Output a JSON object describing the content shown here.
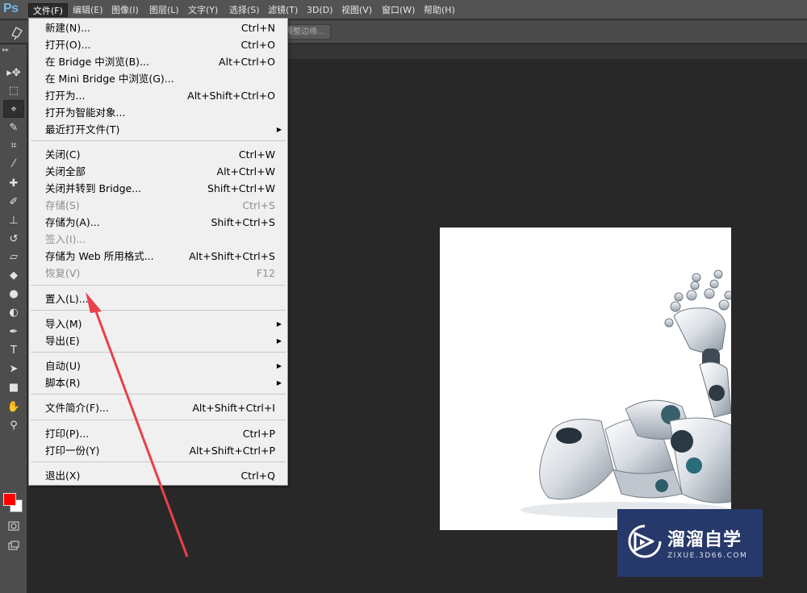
{
  "app": {
    "logo": "Ps"
  },
  "menubar": {
    "items": [
      {
        "label": "文件(F)",
        "active": true
      },
      {
        "label": "编辑(E)"
      },
      {
        "label": "图像(I)"
      },
      {
        "label": "图层(L)"
      },
      {
        "label": "文字(Y)"
      },
      {
        "label": "选择(S)"
      },
      {
        "label": "滤镜(T)"
      },
      {
        "label": "3D(D)"
      },
      {
        "label": "视图(V)"
      },
      {
        "label": "窗口(W)"
      },
      {
        "label": "帮助(H)"
      }
    ]
  },
  "options": {
    "refine_edge_label": "调整边缘..."
  },
  "file_menu": {
    "items": [
      {
        "label": "新建(N)...",
        "shortcut": "Ctrl+N"
      },
      {
        "label": "打开(O)...",
        "shortcut": "Ctrl+O"
      },
      {
        "label": "在 Bridge 中浏览(B)...",
        "shortcut": "Alt+Ctrl+O"
      },
      {
        "label": "在 Mini Bridge 中浏览(G)...",
        "shortcut": ""
      },
      {
        "label": "打开为...",
        "shortcut": "Alt+Shift+Ctrl+O"
      },
      {
        "label": "打开为智能对象...",
        "shortcut": ""
      },
      {
        "label": "最近打开文件(T)",
        "shortcut": "",
        "submenu": true
      },
      {
        "label": "关闭(C)",
        "shortcut": "Ctrl+W"
      },
      {
        "label": "关闭全部",
        "shortcut": "Alt+Ctrl+W"
      },
      {
        "label": "关闭并转到 Bridge...",
        "shortcut": "Shift+Ctrl+W"
      },
      {
        "label": "存储(S)",
        "shortcut": "Ctrl+S",
        "disabled": true
      },
      {
        "label": "存储为(A)...",
        "shortcut": "Shift+Ctrl+S"
      },
      {
        "label": "签入(I)...",
        "shortcut": "",
        "disabled": true
      },
      {
        "label": "存储为 Web 所用格式...",
        "shortcut": "Alt+Shift+Ctrl+S"
      },
      {
        "label": "恢复(V)",
        "shortcut": "F12",
        "disabled": true
      },
      {
        "label": "置入(L)...",
        "shortcut": ""
      },
      {
        "label": "导入(M)",
        "shortcut": "",
        "submenu": true
      },
      {
        "label": "导出(E)",
        "shortcut": "",
        "submenu": true
      },
      {
        "label": "自动(U)",
        "shortcut": "",
        "submenu": true
      },
      {
        "label": "脚本(R)",
        "shortcut": "",
        "submenu": true
      },
      {
        "label": "文件简介(F)...",
        "shortcut": "Alt+Shift+Ctrl+I"
      },
      {
        "label": "打印(P)...",
        "shortcut": "Ctrl+P"
      },
      {
        "label": "打印一份(Y)",
        "shortcut": "Alt+Shift+Ctrl+P"
      },
      {
        "label": "退出(X)",
        "shortcut": "Ctrl+Q"
      }
    ]
  },
  "tools": [
    {
      "name": "move-tool-icon",
      "glyph": "▸✥"
    },
    {
      "name": "marquee-tool-icon",
      "glyph": "⬚"
    },
    {
      "name": "lasso-tool-icon",
      "glyph": "⌖"
    },
    {
      "name": "quick-select-tool-icon",
      "glyph": "✎"
    },
    {
      "name": "crop-tool-icon",
      "glyph": "⌗"
    },
    {
      "name": "eyedropper-tool-icon",
      "glyph": "⁄"
    },
    {
      "name": "healing-brush-tool-icon",
      "glyph": "✚"
    },
    {
      "name": "brush-tool-icon",
      "glyph": "✐"
    },
    {
      "name": "clone-stamp-tool-icon",
      "glyph": "⊥"
    },
    {
      "name": "history-brush-tool-icon",
      "glyph": "↺"
    },
    {
      "name": "eraser-tool-icon",
      "glyph": "▱"
    },
    {
      "name": "paint-bucket-tool-icon",
      "glyph": "◆"
    },
    {
      "name": "blur-tool-icon",
      "glyph": "●"
    },
    {
      "name": "dodge-tool-icon",
      "glyph": "◐"
    },
    {
      "name": "pen-tool-icon",
      "glyph": "✒"
    },
    {
      "name": "type-tool-icon",
      "glyph": "T"
    },
    {
      "name": "path-select-tool-icon",
      "glyph": "➤"
    },
    {
      "name": "rectangle-tool-icon",
      "glyph": "■"
    },
    {
      "name": "hand-tool-icon",
      "glyph": "✋"
    },
    {
      "name": "zoom-tool-icon",
      "glyph": "⚲"
    }
  ],
  "colors": {
    "foreground": "#ff0000",
    "background": "#ffffff",
    "annotation_arrow": "#e8414b"
  },
  "watermark": {
    "title": "溜溜自学",
    "subtitle": "ZIXUE.3D66.COM"
  }
}
